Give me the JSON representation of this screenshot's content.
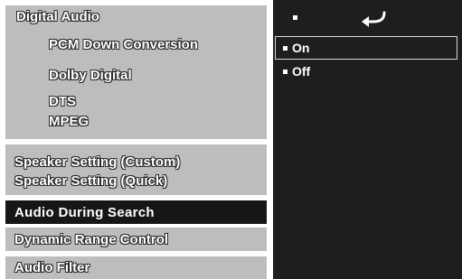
{
  "menu": {
    "digital_audio": "Digital Audio",
    "pcm_down_conversion": "PCM Down Conversion",
    "dolby_digital": "Dolby Digital",
    "dts": "DTS",
    "mpeg": "MPEG",
    "speaker_setting_custom": "Speaker Setting (Custom)",
    "speaker_setting_quick": "Speaker Setting (Quick)",
    "audio_during_search": "Audio During Search",
    "dynamic_range_control": "Dynamic Range Control",
    "audio_filter": "Audio Filter"
  },
  "options": {
    "header_icon": "return-icon",
    "items": [
      "On",
      "Off"
    ],
    "selected": "On"
  },
  "colors": {
    "menu_bg": "#bdbdbd",
    "selected_bg": "#161616",
    "options_bg": "#1e1e1e"
  }
}
